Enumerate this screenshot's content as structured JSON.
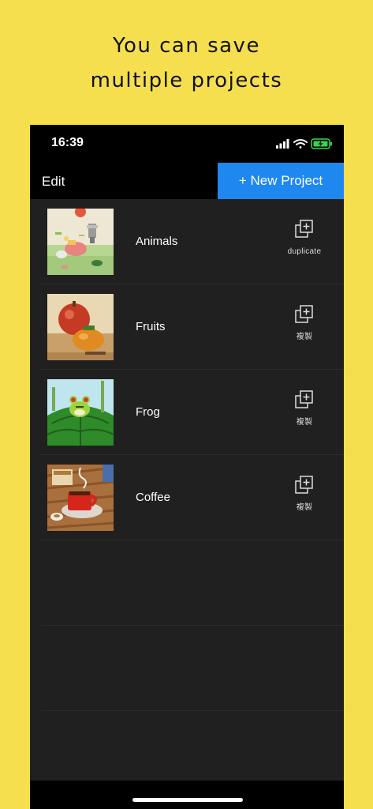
{
  "promo": {
    "line1": "You can save",
    "line2": "multiple projects"
  },
  "status_bar": {
    "time": "16:39",
    "icons": [
      "signal-icon",
      "wifi-icon",
      "battery-charging-icon"
    ],
    "battery_color": "#32d74b"
  },
  "nav": {
    "edit_label": "Edit",
    "new_project_label": "+ New Project",
    "accent": "#1e88f0"
  },
  "projects": [
    {
      "name": "Animals",
      "duplicate_label": "duplicate",
      "thumbnail": "animals-thumbnail"
    },
    {
      "name": "Fruits",
      "duplicate_label": "複製",
      "thumbnail": "fruits-thumbnail"
    },
    {
      "name": "Frog",
      "duplicate_label": "複製",
      "thumbnail": "frog-thumbnail"
    },
    {
      "name": "Coffee",
      "duplicate_label": "複製",
      "thumbnail": "coffee-thumbnail"
    }
  ]
}
